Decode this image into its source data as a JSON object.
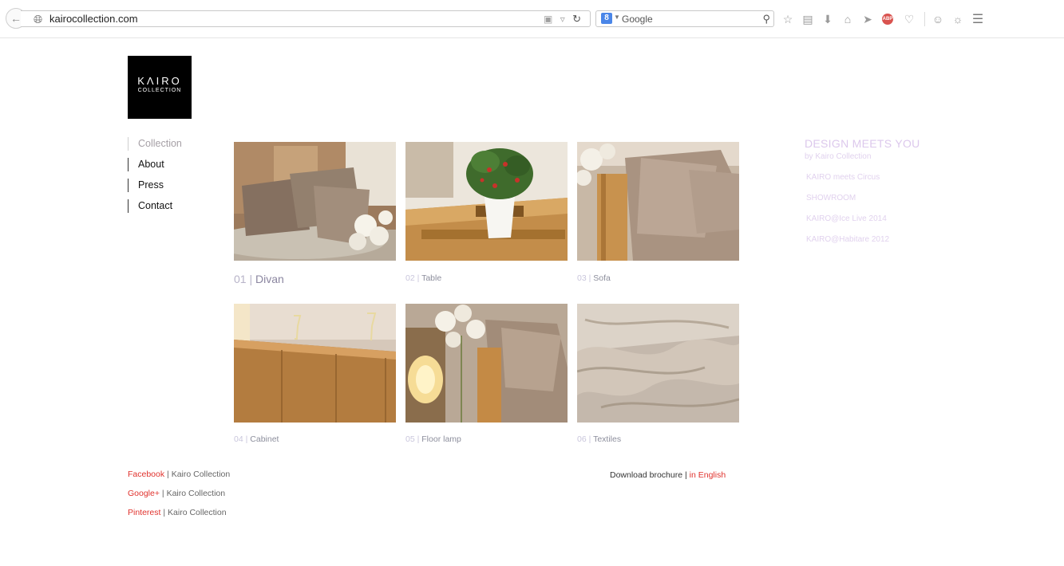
{
  "browser": {
    "url": "kairocollection.com",
    "search_engine_icon": "8",
    "search_placeholder": "Google"
  },
  "logo": {
    "wordmark": "KΛIRO",
    "subtitle": "COLLECTION"
  },
  "nav": [
    {
      "label": "Collection"
    },
    {
      "label": "About"
    },
    {
      "label": "Press"
    },
    {
      "label": "Contact"
    }
  ],
  "products": [
    {
      "number": "01",
      "separator": "|",
      "name": "Divan"
    },
    {
      "number": "02",
      "separator": "|",
      "name": "Table"
    },
    {
      "number": "03",
      "separator": "|",
      "name": "Sofa"
    },
    {
      "number": "04",
      "separator": "|",
      "name": "Cabinet"
    },
    {
      "number": "05",
      "separator": "|",
      "name": "Floor lamp"
    },
    {
      "number": "06",
      "separator": "|",
      "name": "Textiles"
    }
  ],
  "sidebar": {
    "title": "DESIGN MEETS YOU",
    "subtitle": "by Kairo Collection",
    "links": [
      "KAIRO meets Circus",
      "SHOWROOM",
      "KAIRO@Ice Live 2014",
      "KAIRO@Habitare 2012"
    ]
  },
  "social": [
    {
      "network": "Facebook",
      "separator": "|",
      "label": "Kairo Collection"
    },
    {
      "network": "Google+",
      "separator": "|",
      "label": "Kairo Collection"
    },
    {
      "network": "Pinterest",
      "separator": "|",
      "label": "Kairo Collection"
    }
  ],
  "download": {
    "label": "Download brochure",
    "separator": "|",
    "link": "in English"
  },
  "colors": {
    "link_red": "#e0322d",
    "sidebar_lavender": "#dcc8ec",
    "caption_gray": "#8c8e9c"
  }
}
